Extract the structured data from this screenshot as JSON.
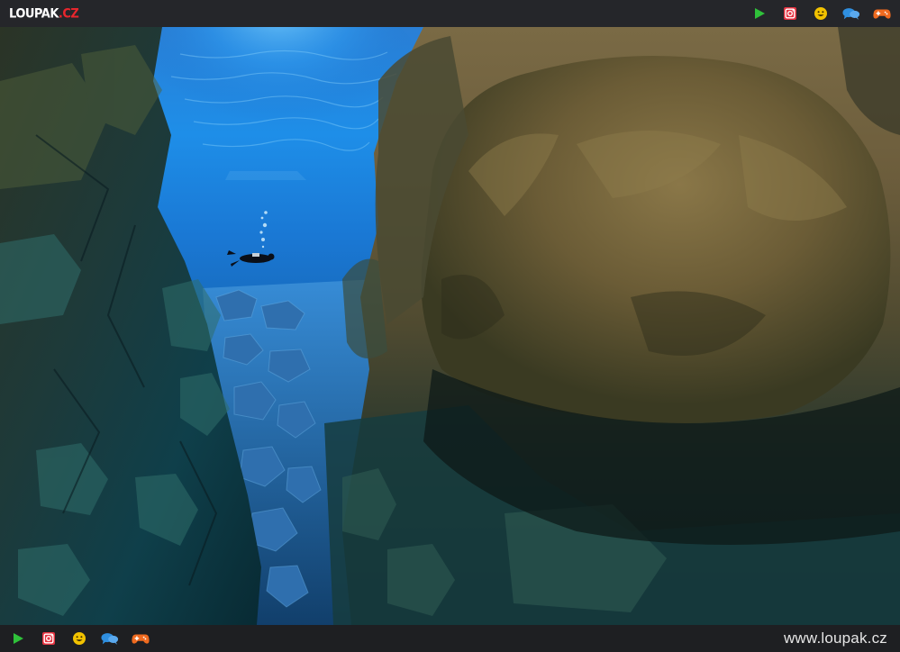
{
  "header": {
    "logo_main": "LOUPAK",
    "logo_dot": ".",
    "logo_tld": "CZ"
  },
  "icons": [
    "play-icon",
    "instagram-icon",
    "smiley-icon",
    "chat-icon",
    "gamepad-icon"
  ],
  "colors": {
    "bar": "#25262a",
    "play": "#2fc13a",
    "instagram": "#e53341",
    "smiley": "#f2c200",
    "chat": "#2f8fe0",
    "gamepad": "#ef6a1f",
    "logo_accent": "#e8262d"
  },
  "footer": {
    "site_url": "www.loupak.cz"
  }
}
